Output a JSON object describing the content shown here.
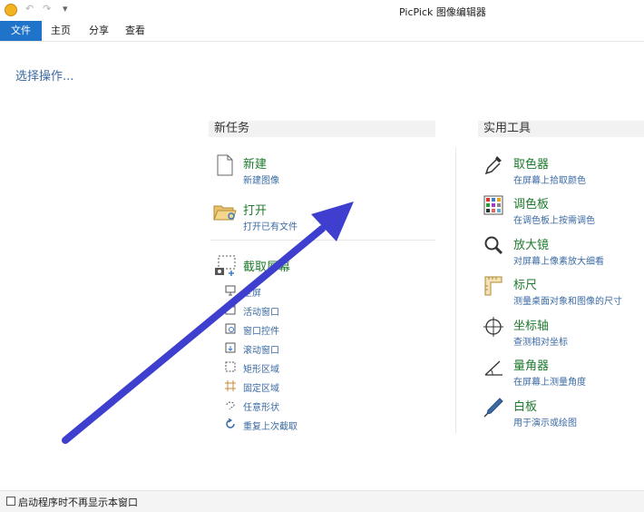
{
  "window": {
    "title": "PicPick 图像编辑器"
  },
  "quick_access": {
    "undo": "↶",
    "redo": "↷",
    "more": "▾"
  },
  "ribbon": {
    "tabs": [
      "文件",
      "主页",
      "分享",
      "查看"
    ]
  },
  "prompt": "选择操作...",
  "new_task": {
    "header": "新任务",
    "new": {
      "title": "新建",
      "sub": "新建图像"
    },
    "open": {
      "title": "打开",
      "sub": "打开已有文件"
    },
    "capture": {
      "title": "截取屏幕",
      "items": [
        "全屏",
        "活动窗口",
        "窗口控件",
        "滚动窗口",
        "矩形区域",
        "固定区域",
        "任意形状",
        "重复上次截取"
      ]
    }
  },
  "tools": {
    "header": "实用工具",
    "items": [
      {
        "title": "取色器",
        "sub": "在屏幕上拾取颜色"
      },
      {
        "title": "调色板",
        "sub": "在调色板上按需调色"
      },
      {
        "title": "放大镜",
        "sub": "对屏幕上像素放大细看"
      },
      {
        "title": "标尺",
        "sub": "测量桌面对象和图像的尺寸"
      },
      {
        "title": "坐标轴",
        "sub": "查测相对坐标"
      },
      {
        "title": "量角器",
        "sub": "在屏幕上测量角度"
      },
      {
        "title": "白板",
        "sub": "用于演示或绘图"
      }
    ]
  },
  "footer": {
    "checkbox_label": "启动程序时不再显示本窗口"
  },
  "colors": {
    "accent": "#1f73c9",
    "title_green": "#1f7a2e",
    "sub_blue": "#3a6aa3",
    "arrow": "#3f3fcf"
  }
}
